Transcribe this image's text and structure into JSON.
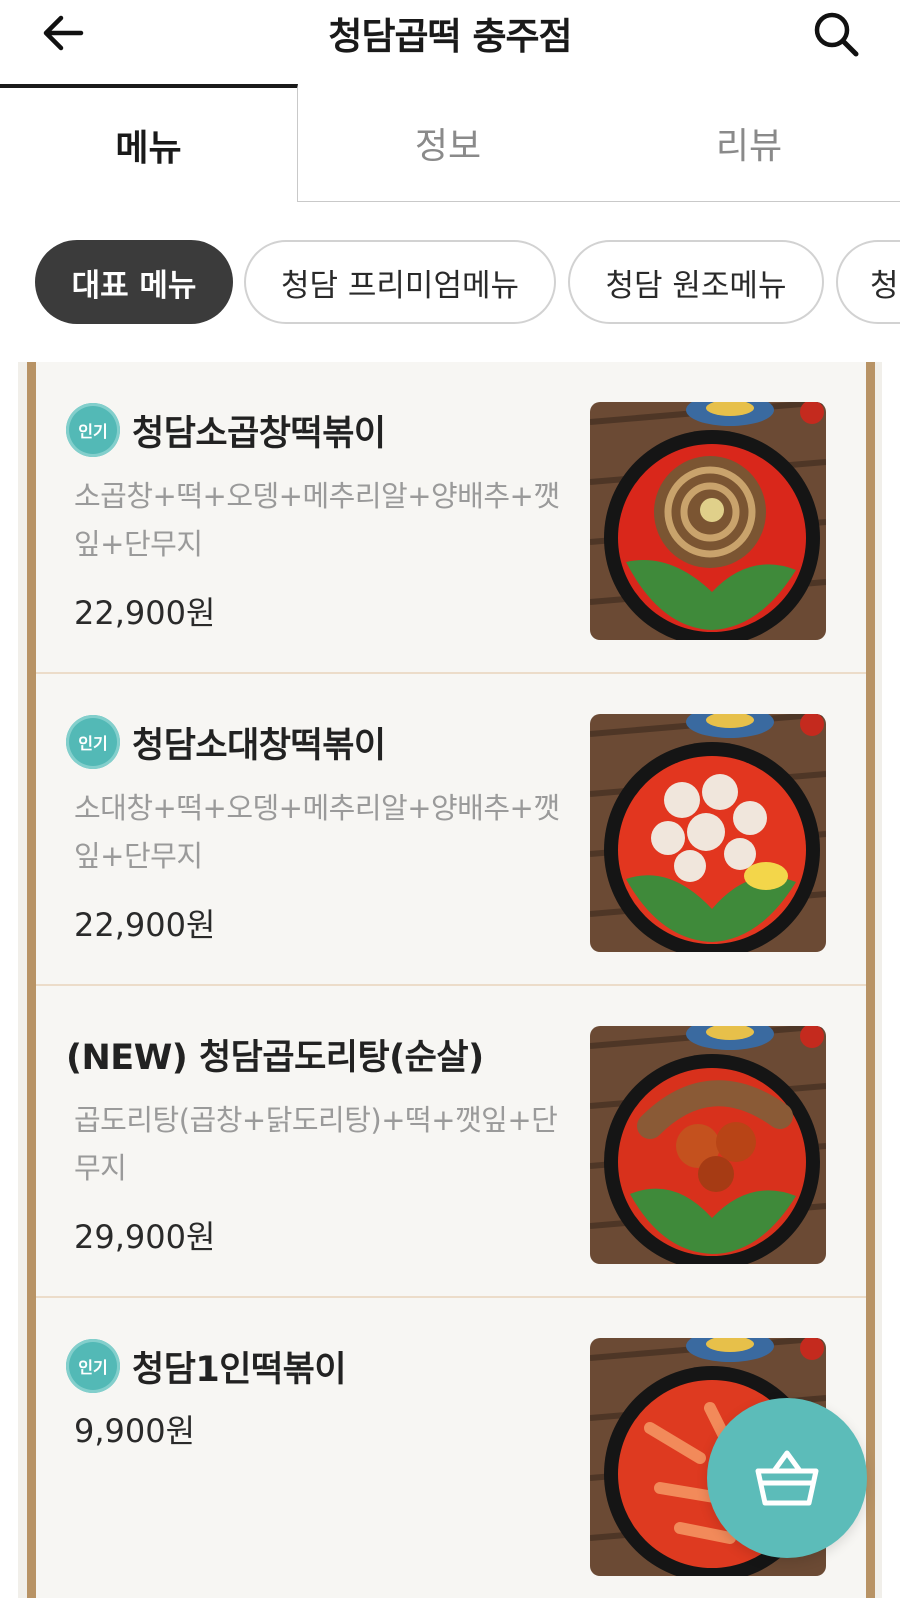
{
  "header": {
    "title": "청담곱떡 충주점",
    "back_icon": "arrow-left-icon",
    "search_icon": "search-icon"
  },
  "tabs": [
    {
      "label": "메뉴",
      "active": true
    },
    {
      "label": "정보",
      "active": false
    },
    {
      "label": "리뷰",
      "active": false
    }
  ],
  "categories": [
    {
      "label": "대표 메뉴",
      "selected": true
    },
    {
      "label": "청담 프리미엄메뉴",
      "selected": false
    },
    {
      "label": "청담 원조메뉴",
      "selected": false
    },
    {
      "label": "청",
      "selected": false
    }
  ],
  "menu_items": [
    {
      "badge": "인기",
      "name": "청담소곱창떡볶이",
      "description": "소곱창+떡+오뎅+메추리알+양배추+깻잎+단무지",
      "price": "22,900원"
    },
    {
      "badge": "인기",
      "name": "청담소대창떡볶이",
      "description": "소대창+떡+오뎅+메추리알+양배추+깻잎+단무지",
      "price": "22,900원"
    },
    {
      "badge": "",
      "name": "(NEW) 청담곱도리탕(순살)",
      "description": "곱도리탕(곱창+닭도리탕)+떡+깻잎+단무지",
      "price": "29,900원"
    },
    {
      "badge": "인기",
      "name": "청담1인떡볶이",
      "description": "",
      "price": "9,900원"
    }
  ],
  "cart": {
    "icon": "shopping-basket-icon"
  },
  "colors": {
    "accent_teal": "#5cbcb9",
    "chip_selected": "#3b3b3b",
    "frame_wood": "#b89365",
    "panel_bg": "#f7f6f3"
  }
}
